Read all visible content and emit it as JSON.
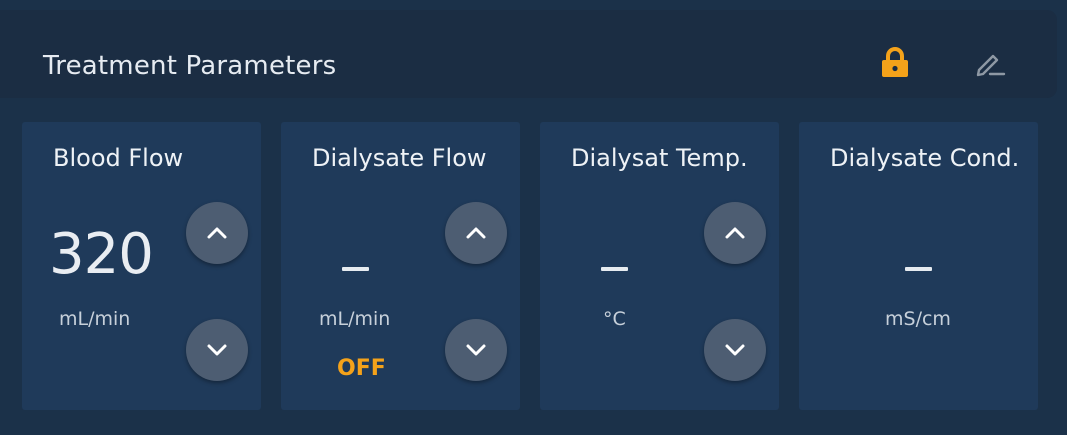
{
  "header": {
    "title": "Treatment Parameters",
    "lock_icon": "lock-icon",
    "edit_icon": "pencil-icon"
  },
  "colors": {
    "accent": "#f4a21a",
    "card": "#1f3a5a",
    "button": "#4d5d72"
  },
  "cards": [
    {
      "title": "Blood Flow",
      "value": "320",
      "unit": "mL/min",
      "status": ""
    },
    {
      "title": "Dialysate Flow",
      "value": "",
      "unit": "mL/min",
      "status": "OFF"
    },
    {
      "title": "Dialysat Temp.",
      "value": "",
      "unit": "°C",
      "status": ""
    },
    {
      "title": "Dialysate Cond.",
      "value": "",
      "unit": "mS/cm",
      "status": ""
    }
  ]
}
